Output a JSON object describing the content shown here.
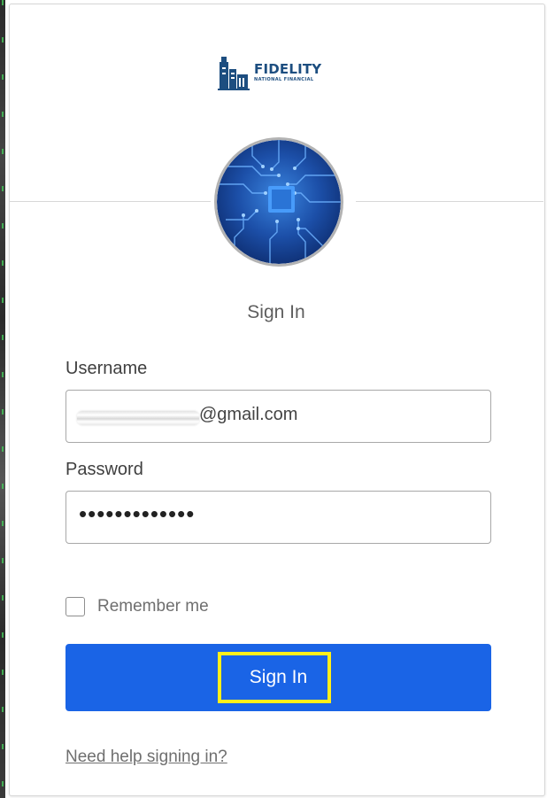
{
  "brand": {
    "logo_word": "FIDELITY",
    "logo_subtitle": "NATIONAL FINANCIAL",
    "logo_icon": "building-icon",
    "color": "#1d4e80"
  },
  "avatar": {
    "icon": "circuit-board-image"
  },
  "form": {
    "title": "Sign In",
    "username": {
      "label": "Username",
      "value": "@gmail.com"
    },
    "password": {
      "label": "Password",
      "value": "•••••••••••••"
    },
    "remember_me": {
      "label": "Remember me",
      "checked": false
    },
    "submit": {
      "label": "Sign In",
      "color": "#1a64e6",
      "highlight_color": "#ffef1a"
    },
    "help_link": "Need help signing in?"
  }
}
